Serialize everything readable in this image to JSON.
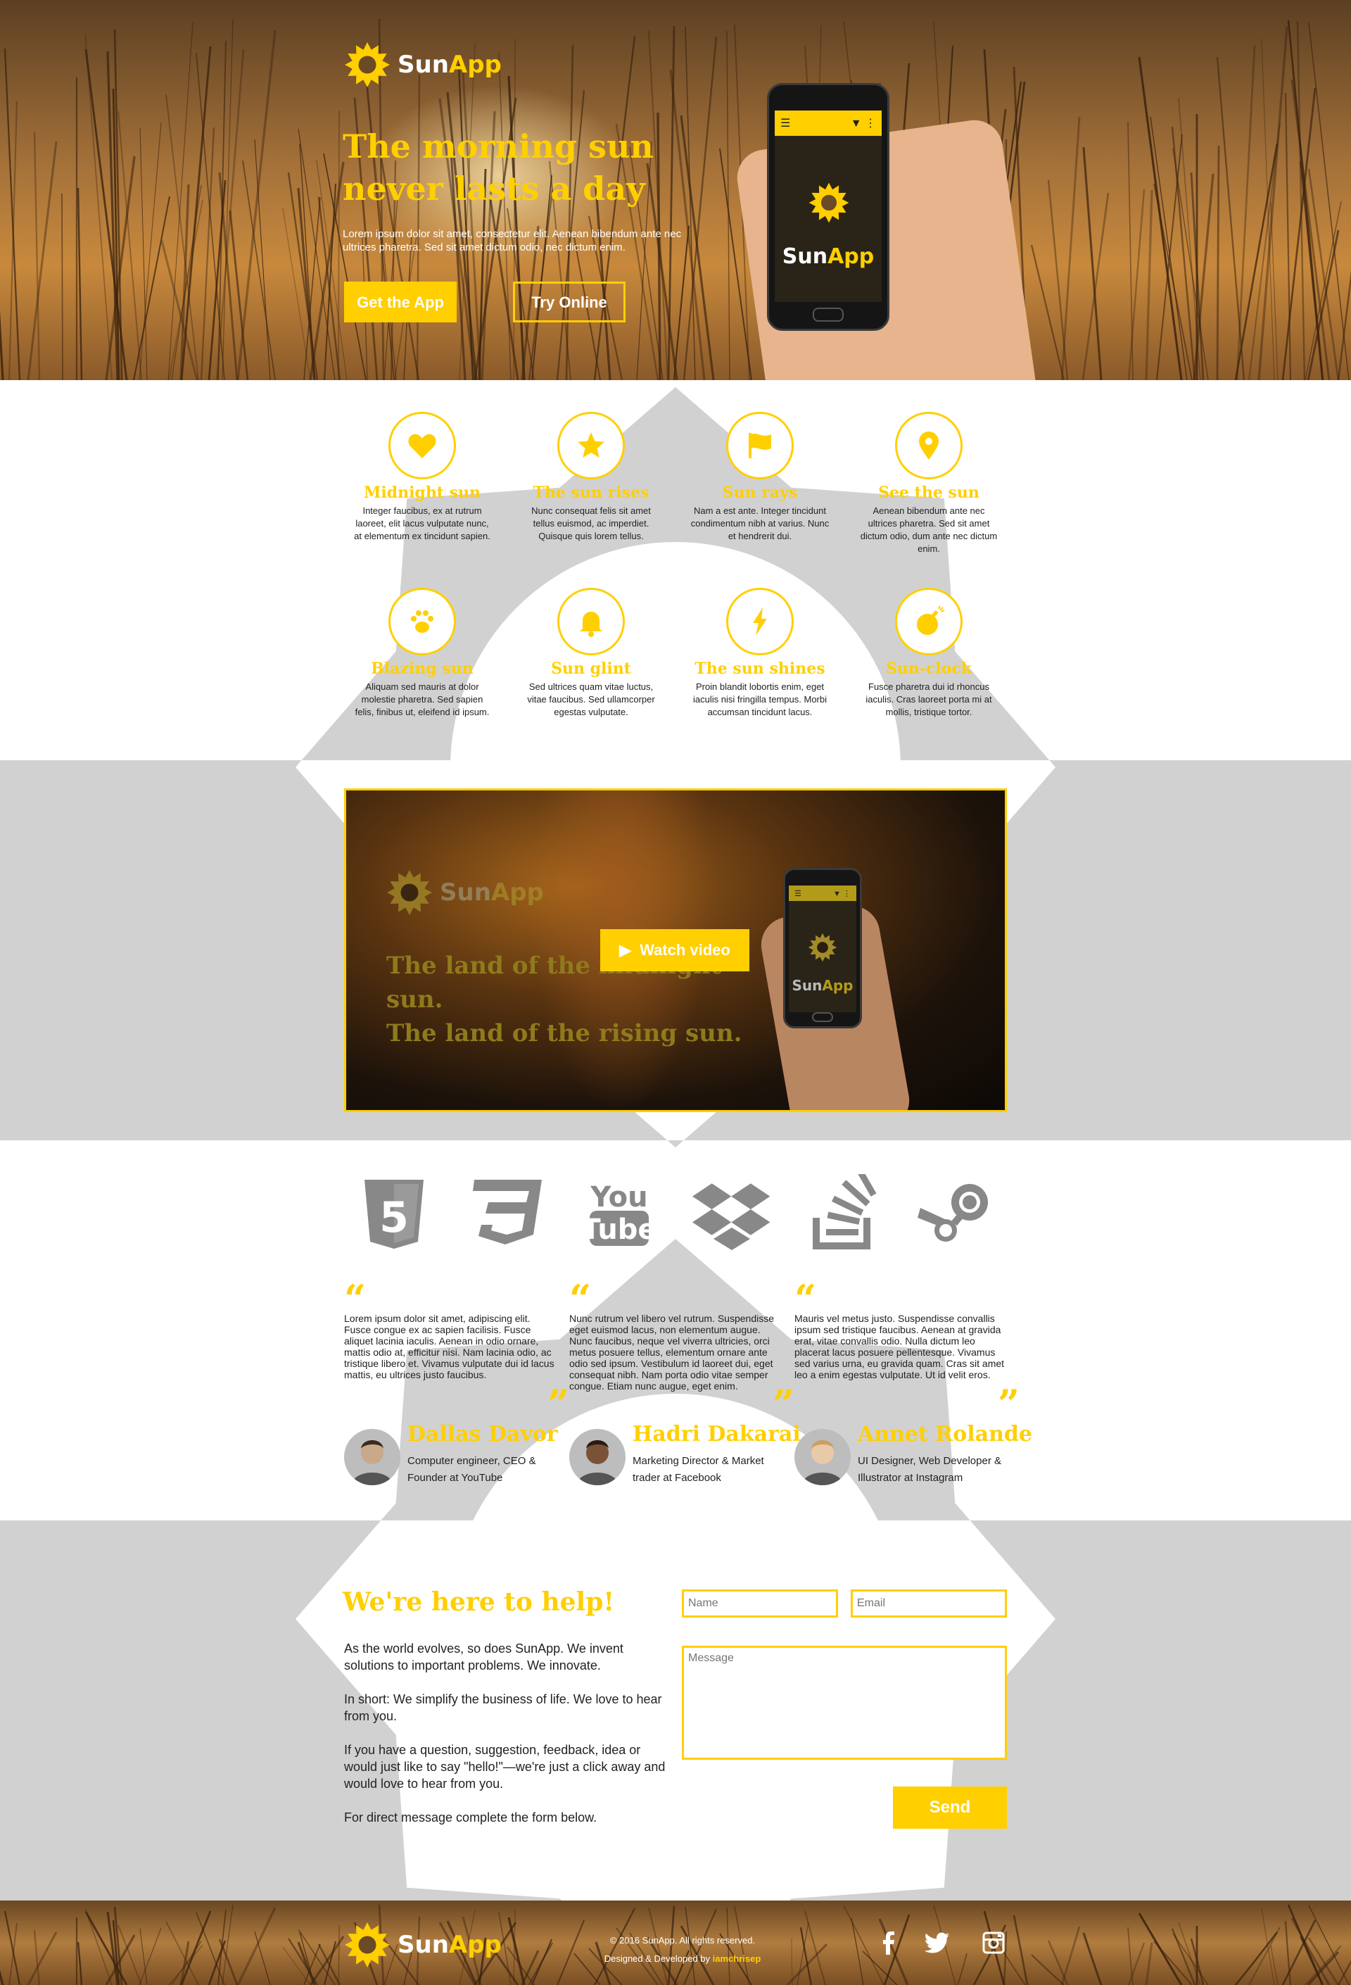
{
  "brand": {
    "name_part1": "Sun",
    "name_part2": "App"
  },
  "hero": {
    "headline_line1": "The morning sun",
    "headline_line2": "never lasts a day",
    "body": "Lorem ipsum dolor sit amet, consectetur elit. Aenean bibendum ante nec ultrices pharetra. Sed sit amet dictum odio, nec dictum enim.",
    "get_app_label": "Get the App",
    "try_online_label": "Try Online"
  },
  "features": [
    {
      "icon": "heart-icon",
      "title": "Midnight sun",
      "text": "Integer faucibus, ex at rutrum laoreet, elit lacus vulputate nunc, at elementum ex tincidunt sapien."
    },
    {
      "icon": "star-icon",
      "title": "The sun rises",
      "text": "Nunc consequat felis sit amet tellus euismod, ac imperdiet. Quisque quis lorem tellus."
    },
    {
      "icon": "flag-icon",
      "title": "Sun rays",
      "text": "Nam a est ante. Integer tincidunt condimentum nibh at varius. Nunc et hendrerit dui."
    },
    {
      "icon": "map-pin-icon",
      "title": "See the sun",
      "text": "Aenean bibendum ante nec ultrices pharetra. Sed sit amet dictum odio, dum ante nec dictum enim."
    },
    {
      "icon": "paw-icon",
      "title": "Blazing sun",
      "text": "Aliquam sed mauris at dolor molestie pharetra. Sed sapien felis, finibus ut, eleifend id ipsum."
    },
    {
      "icon": "bell-icon",
      "title": "Sun glint",
      "text": "Sed ultrices quam vitae luctus, vitae faucibus. Sed ullamcorper egestas vulputate."
    },
    {
      "icon": "lightning-icon",
      "title": "The sun shines",
      "text": "Proin blandit lobortis enim, eget iaculis nisi fringilla tempus. Morbi accumsan tincidunt lacus."
    },
    {
      "icon": "bomb-icon",
      "title": "Sun-clock",
      "text": "Fusce pharetra dui id rhoncus iaculis. Cras laoreet porta mi at mollis, tristique tortor."
    }
  ],
  "video": {
    "line1": "The land of the midnight sun.",
    "line2": "The land of the rising sun.",
    "watch_label": "Watch video"
  },
  "brands": [
    "html5-icon",
    "css3-icon",
    "youtube-icon",
    "dropbox-icon",
    "stackoverflow-icon",
    "steam-icon"
  ],
  "testimonials": [
    {
      "quote": "Lorem ipsum dolor sit amet, adipiscing elit. Fusce congue ex ac sapien facilisis. Fusce aliquet lacinia iaculis. Aenean in odio ornare, mattis odio at, efficitur nisi. Nam lacinia odio, ac tristique libero et. Vivamus vulputate dui id lacus mattis, eu ultrices justo faucibus.",
      "name": "Dallas Davor",
      "role": "Computer engineer, CEO & Founder at YouTube"
    },
    {
      "quote": "Nunc rutrum vel libero vel rutrum. Suspendisse eget euismod lacus, non elementum augue. Nunc faucibus, neque vel viverra ultricies, orci metus posuere tellus, elementum ornare ante odio sed ipsum. Vestibulum id laoreet dui, eget consequat nibh. Nam porta odio vitae semper congue. Etiam nunc augue, eget enim.",
      "name": "Hadri Dakarai",
      "role": "Marketing Director & Market trader at Facebook"
    },
    {
      "quote": "Mauris vel metus justo. Suspendisse convallis ipsum sed tristique faucibus. Aenean at gravida erat, vitae convallis odio. Nulla dictum leo placerat lacus posuere pellentesque. Vivamus sed varius urna, eu gravida quam. Cras sit amet leo a enim egestas vulputate. Ut id velit eros.",
      "name": "Annet Rolande",
      "role": "UI Designer, Web Developer & Illustrator at Instagram"
    }
  ],
  "contact": {
    "heading": "We're here to help!",
    "p1": "As the world evolves, so does SunApp. We invent solutions to important problems. We innovate.",
    "p2": "In short: We simplify the business of life. We love to hear from you.",
    "p3": "If you have a question, suggestion, feedback, idea or would just like to say \"hello!\"—we're just a click away and would love to hear from you.",
    "p4": "For direct message complete the form below.",
    "name_placeholder": "Name",
    "email_placeholder": "Email",
    "message_placeholder": "Message",
    "send_label": "Send"
  },
  "footer": {
    "copyright": "© 2016 SunApp. All rights reserved.",
    "credit_prefix": "Designed & Developed by ",
    "credit_name": "iamchrisep",
    "social": [
      "facebook-icon",
      "twitter-icon",
      "instagram-icon"
    ]
  },
  "colors": {
    "accent": "#ffcf00",
    "gray_band": "#d1d1d1"
  }
}
